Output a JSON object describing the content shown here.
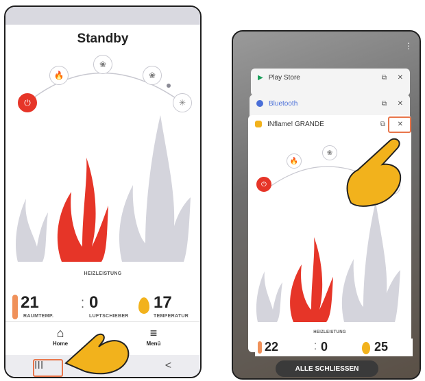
{
  "left_screen": {
    "title": "Standby",
    "heat_label": "HEIZLEISTUNG",
    "stats": [
      {
        "value": "21",
        "label": "RAUMTEMP."
      },
      {
        "value": "0",
        "label": "LUFTSCHIEBER"
      },
      {
        "value": "17",
        "label": "TEMPERATUR"
      }
    ],
    "menu": [
      {
        "label": "Home"
      },
      {
        "label": "Menü"
      }
    ],
    "nav": {
      "recent": "III",
      "home": "○",
      "back": "<"
    }
  },
  "right_screen": {
    "cards": [
      {
        "title": "Play Store"
      },
      {
        "title": "Bluetooth"
      },
      {
        "title": "INflame! GRANDE"
      }
    ],
    "heat_label": "HEIZLEISTUNG",
    "stats": [
      {
        "value": "22"
      },
      {
        "value": "0"
      },
      {
        "value": "25"
      }
    ],
    "close_all": "ALLE SCHLIESSEN"
  },
  "colors": {
    "accent_red": "#e63528",
    "flame_grey": "#d4d4dc",
    "highlight": "#e8754a",
    "hand": "#f2b21c"
  },
  "icons": [
    "flame-icon",
    "close-icon",
    "split-screen-icon",
    "home-icon",
    "menu-icon",
    "snowflake-icon",
    "thermometer-icon",
    "power-icon",
    "pointing-hand-icon"
  ]
}
